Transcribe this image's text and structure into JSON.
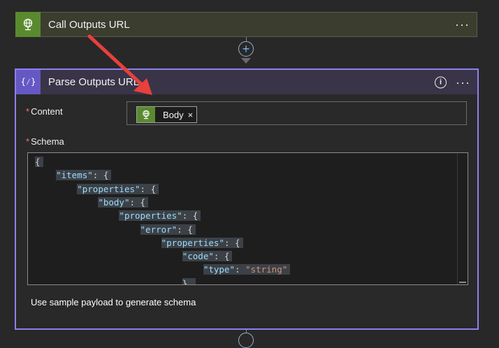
{
  "step1": {
    "title": "Call Outputs URL",
    "more": "···"
  },
  "connector": {
    "plus": "+"
  },
  "step2": {
    "title": "Parse Outputs URL",
    "info": "i",
    "more": "···",
    "icon_text": "{⁄}",
    "content_label": "Content",
    "required_marker": "*",
    "token_label": "Body",
    "token_remove": "×",
    "schema_label": "Schema",
    "schema_lines": [
      {
        "indent": 0,
        "key": "",
        "rest": "{"
      },
      {
        "indent": 1,
        "key": "\"items\"",
        "rest": ": {"
      },
      {
        "indent": 2,
        "key": "\"properties\"",
        "rest": ": {"
      },
      {
        "indent": 3,
        "key": "\"body\"",
        "rest": ": {"
      },
      {
        "indent": 4,
        "key": "\"properties\"",
        "rest": ": {"
      },
      {
        "indent": 5,
        "key": "\"error\"",
        "rest": ": {"
      },
      {
        "indent": 6,
        "key": "\"properties\"",
        "rest": ": {"
      },
      {
        "indent": 7,
        "key": "\"code\"",
        "rest": ": {"
      },
      {
        "indent": 8,
        "key": "\"type\"",
        "rest": ": ",
        "value": "\"string\""
      },
      {
        "indent": 7,
        "key": "",
        "rest": "},"
      }
    ],
    "sample_payload_link": "Use sample payload to generate schema"
  },
  "colors": {
    "step1_accent": "#5a8a2f",
    "step2_accent": "#6658c4",
    "step2_border": "#8d7ff0",
    "annotation_arrow": "#e8403c"
  }
}
